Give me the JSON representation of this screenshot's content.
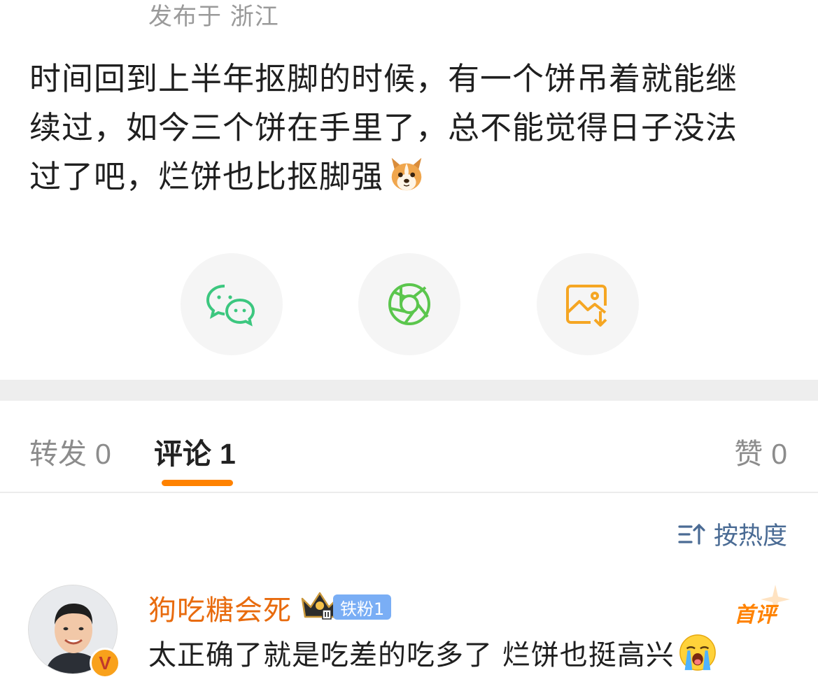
{
  "post": {
    "published_at": "发布于 浙江",
    "text_line1": "时间回到上半年抠脚的时候，有一个饼吊着就能继",
    "text_line2": "续过，如今三个饼在手里了，总不能觉得日子没法",
    "text_line3": "过了吧，烂饼也比抠脚强",
    "emoji": "dog-emoji"
  },
  "share": {
    "items": [
      {
        "icon": "wechat-icon",
        "color": "#3cc77f"
      },
      {
        "icon": "moments-icon",
        "color": "#5bc64d"
      },
      {
        "icon": "save-image-icon",
        "color": "#f5a623"
      }
    ]
  },
  "tabs": {
    "repost": {
      "label": "转发",
      "count": "0"
    },
    "comment": {
      "label": "评论",
      "count": "1"
    },
    "like": {
      "label": "赞",
      "count": "0"
    }
  },
  "sort": {
    "label": "按热度"
  },
  "comments": [
    {
      "username": "狗吃糖会死",
      "fan_badge": "铁粉1",
      "first_label": "首评",
      "text": "太正确了就是吃差的吃多了 烂饼也挺高兴",
      "verified": "V"
    }
  ],
  "colors": {
    "accent": "#ff8200",
    "username": "#e86b0e",
    "link": "#4a6b94",
    "muted": "#8c8c8c"
  }
}
